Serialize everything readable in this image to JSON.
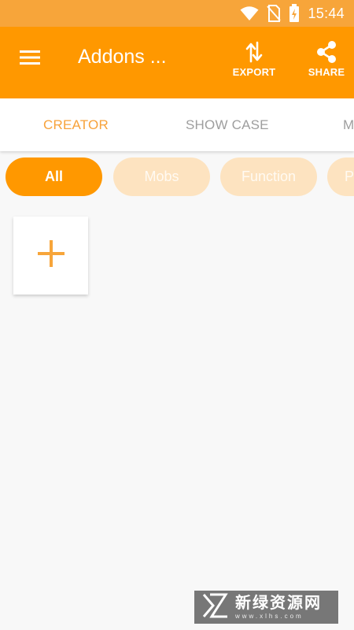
{
  "status_bar": {
    "time": "15:44",
    "icons": [
      "wifi-icon",
      "no-sim-icon",
      "battery-charging-icon"
    ]
  },
  "app_bar": {
    "title": "Addons ...",
    "menu_icon": "hamburger-menu-icon",
    "actions": [
      {
        "label": "EXPORT",
        "icon": "export-arrows-icon"
      },
      {
        "label": "SHARE",
        "icon": "share-icon"
      }
    ]
  },
  "tabs": [
    {
      "label": "CREATOR",
      "selected": true
    },
    {
      "label": "SHOW CASE",
      "selected": false
    },
    {
      "label": "M",
      "selected": false
    }
  ],
  "filters": [
    {
      "label": "All",
      "selected": true
    },
    {
      "label": "Mobs",
      "selected": false
    },
    {
      "label": "Function",
      "selected": false
    },
    {
      "label": "P",
      "selected": false
    }
  ],
  "add_card": {
    "icon": "plus-icon"
  },
  "watermark": {
    "title": "新绿资源网",
    "subtitle": "www.xlhs.com"
  },
  "colors": {
    "accent": "#ff9800",
    "status_bar": "#f7a53a",
    "tab_selected": "#f7a23a",
    "tab_unselected": "#9e9e9e",
    "chip_inactive": "#fde3c0",
    "background": "#f8f8f8"
  }
}
